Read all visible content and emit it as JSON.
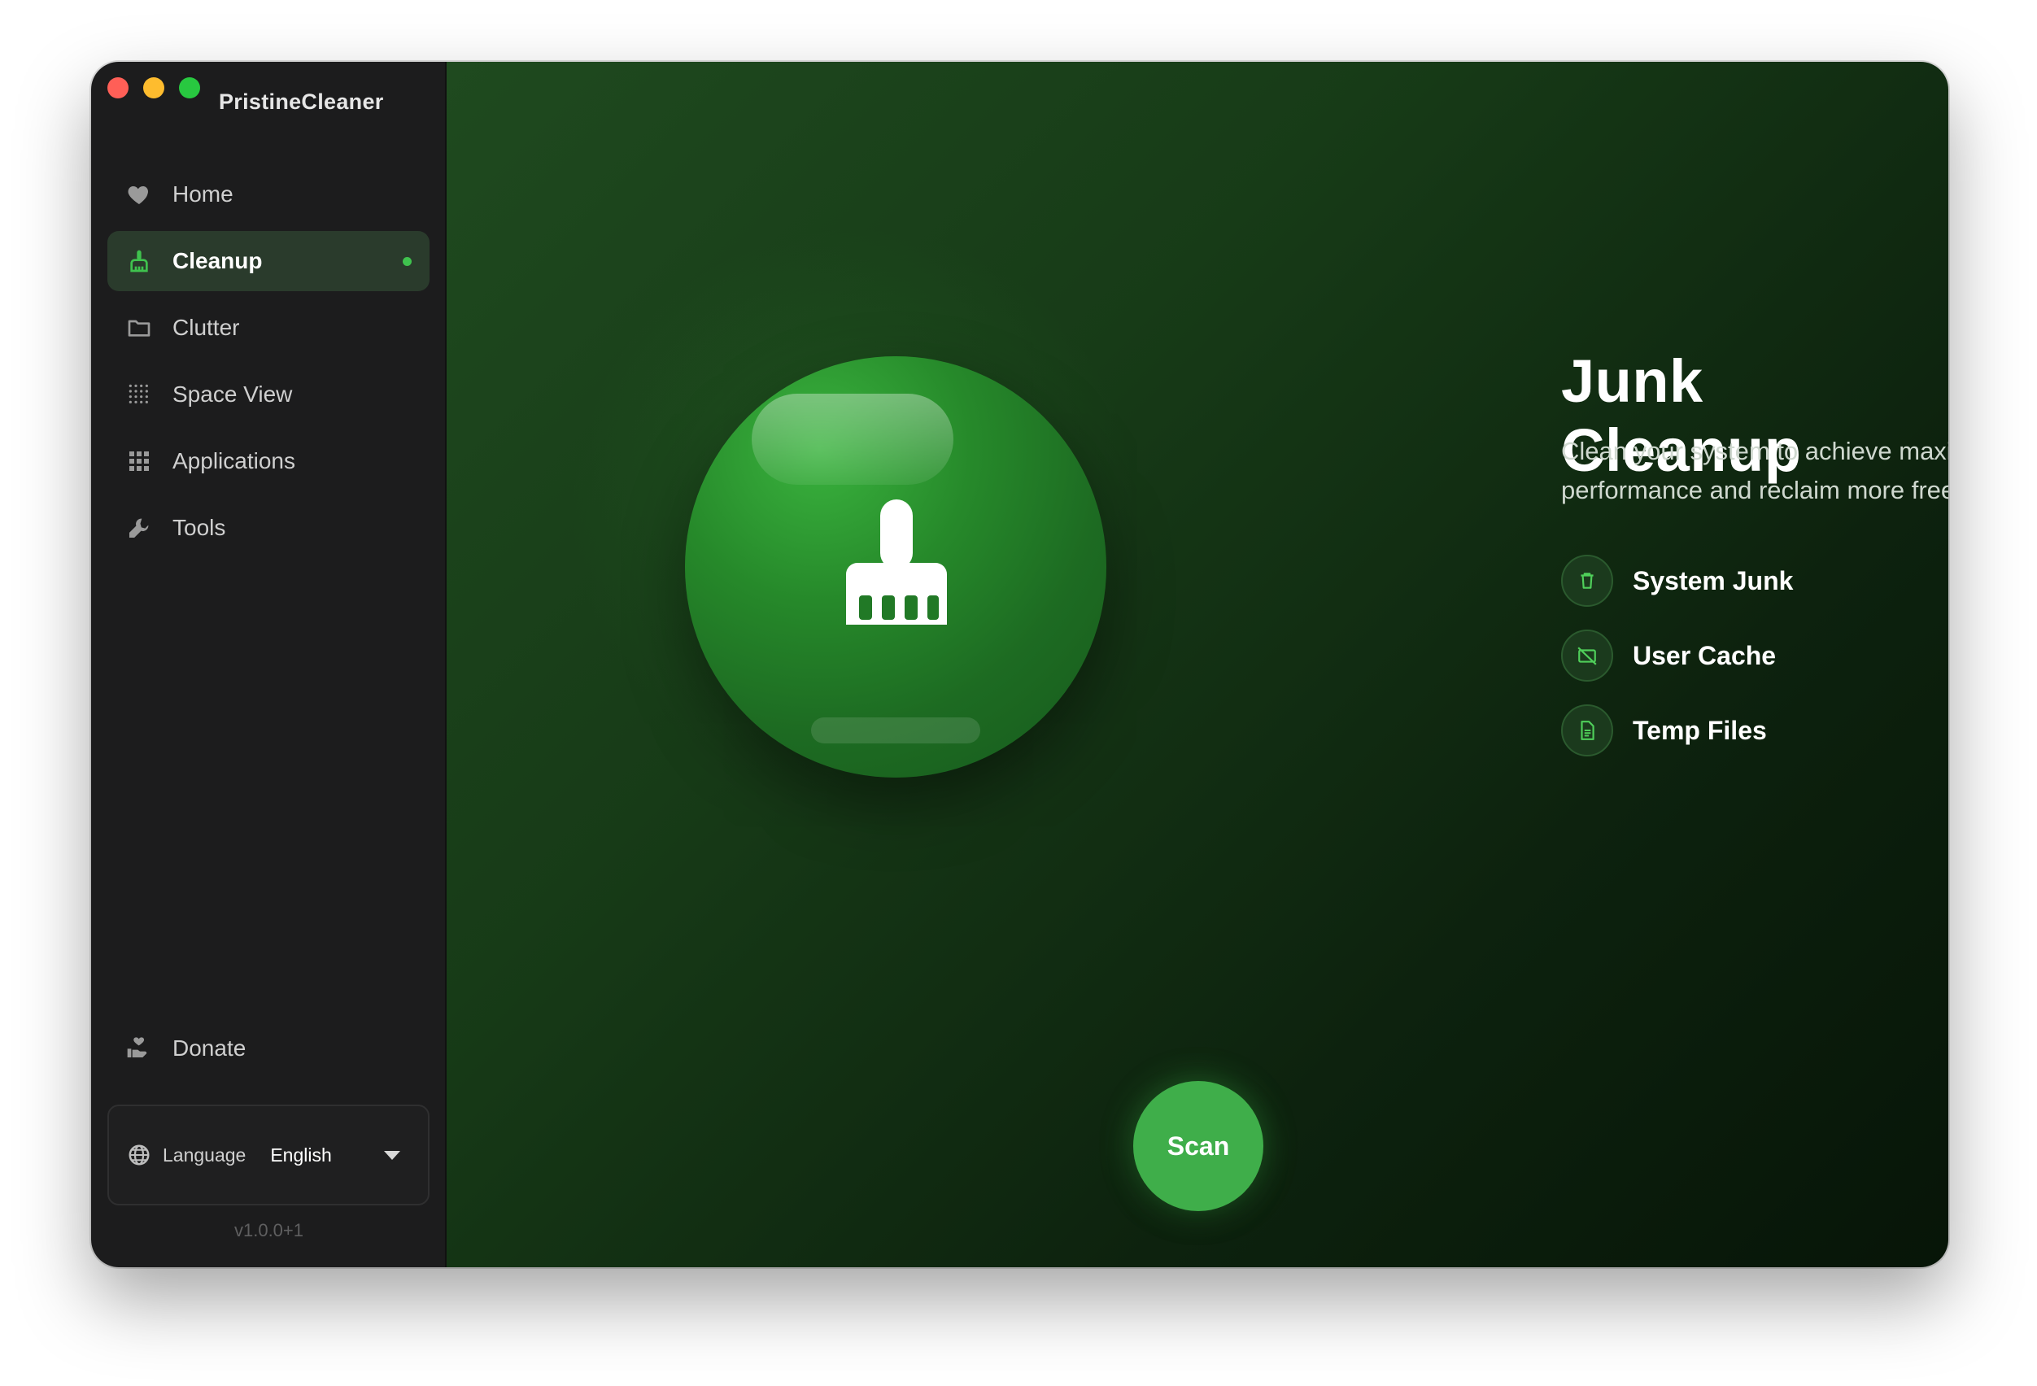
{
  "app": {
    "title": "PristineCleaner"
  },
  "sidebar": {
    "items": [
      {
        "label": "Home",
        "icon": "heart-icon"
      },
      {
        "label": "Cleanup",
        "icon": "broom-icon",
        "active": true
      },
      {
        "label": "Clutter",
        "icon": "folder-icon"
      },
      {
        "label": "Space View",
        "icon": "dot-grid-icon"
      },
      {
        "label": "Applications",
        "icon": "apps-grid-icon"
      },
      {
        "label": "Tools",
        "icon": "wrench-icon"
      }
    ],
    "donate_label": "Donate",
    "language": {
      "label": "Language",
      "value": "English"
    },
    "version": "v1.0.0+1"
  },
  "main": {
    "title": "Junk Cleanup",
    "subtitle": "Clean your system to achieve maximum performance and reclaim more free space.",
    "features": [
      {
        "label": "System Junk",
        "icon": "trash-icon"
      },
      {
        "label": "User Cache",
        "icon": "cache-icon"
      },
      {
        "label": "Temp Files",
        "icon": "document-icon"
      }
    ],
    "scan_label": "Scan"
  },
  "colors": {
    "accent": "#3fae4a",
    "sidebar_bg": "#1c1c1d",
    "active_bg": "#2a3b2c",
    "main_bg_start": "#1f4a1f",
    "main_bg_end": "#071508"
  }
}
